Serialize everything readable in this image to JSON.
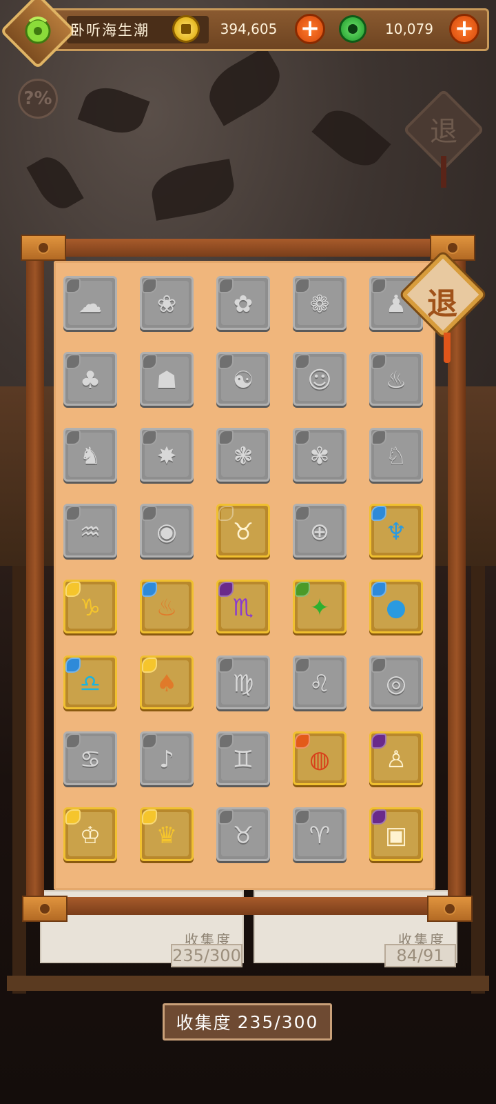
{
  "player": {
    "name": "卧听海生潮"
  },
  "currencies": [
    {
      "type": "gold-coin",
      "value": "394,605",
      "color": "#f5c52c"
    },
    {
      "type": "jade-coin",
      "value": "10,079",
      "color": "#2fb02f"
    }
  ],
  "buttons": {
    "add": "+",
    "help": "?%",
    "exit": "退"
  },
  "collection": {
    "label": "收集度",
    "progress": "235/300",
    "background_panels": [
      {
        "label": "收集度",
        "progress": "235/300"
      },
      {
        "label": "收集度",
        "progress": "84/91"
      }
    ]
  },
  "colors": {
    "accent": "#e0551a",
    "paper": "#f0b67c",
    "frame": "#8a4a20",
    "gold_border": "#f0c030"
  },
  "cards": [
    {
      "glyph": "☁",
      "state": "locked",
      "element": "sun"
    },
    {
      "glyph": "❀",
      "state": "locked",
      "element": "wind"
    },
    {
      "glyph": "✿",
      "state": "locked",
      "element": "water"
    },
    {
      "glyph": "❁",
      "state": "locked",
      "element": "earth"
    },
    {
      "glyph": "♟",
      "state": "locked",
      "element": "water"
    },
    {
      "glyph": "♣",
      "state": "locked",
      "element": "water"
    },
    {
      "glyph": "☗",
      "state": "locked",
      "element": "earth"
    },
    {
      "glyph": "☯",
      "state": "locked",
      "element": "dark"
    },
    {
      "glyph": "☺",
      "state": "locked",
      "element": "sun"
    },
    {
      "glyph": "♨",
      "state": "locked",
      "element": "water"
    },
    {
      "glyph": "♞",
      "state": "locked",
      "element": "water"
    },
    {
      "glyph": "✸",
      "state": "locked",
      "element": "sun"
    },
    {
      "glyph": "❃",
      "state": "locked",
      "element": "wind"
    },
    {
      "glyph": "✾",
      "state": "locked",
      "element": "water"
    },
    {
      "glyph": "♘",
      "state": "locked",
      "element": "earth"
    },
    {
      "glyph": "♒",
      "state": "locked",
      "element": "water"
    },
    {
      "glyph": "◉",
      "state": "locked",
      "element": "dark"
    },
    {
      "glyph": "♉",
      "state": "unlocked",
      "element": "earth",
      "tint": "cream"
    },
    {
      "glyph": "⊕",
      "state": "locked",
      "element": "sun"
    },
    {
      "glyph": "♆",
      "state": "unlocked",
      "element": "water",
      "tint": "blue"
    },
    {
      "glyph": "♑",
      "state": "unlocked",
      "element": "sun",
      "tint": "yellow"
    },
    {
      "glyph": "♨",
      "state": "unlocked",
      "element": "water",
      "tint": "orange"
    },
    {
      "glyph": "♏",
      "state": "unlocked",
      "element": "dark",
      "tint": "purple"
    },
    {
      "glyph": "✦",
      "state": "unlocked",
      "element": "wood",
      "tint": "green"
    },
    {
      "glyph": "●",
      "state": "unlocked",
      "element": "water",
      "tint": "blue"
    },
    {
      "glyph": "♎",
      "state": "unlocked",
      "element": "water",
      "tint": "cyan"
    },
    {
      "glyph": "♠",
      "state": "unlocked",
      "element": "sun",
      "tint": "orange"
    },
    {
      "glyph": "♍",
      "state": "locked",
      "element": "earth"
    },
    {
      "glyph": "♌",
      "state": "locked",
      "element": "earth"
    },
    {
      "glyph": "◎",
      "state": "locked",
      "element": "water"
    },
    {
      "glyph": "♋",
      "state": "locked",
      "element": "wind"
    },
    {
      "glyph": "♪",
      "state": "locked",
      "element": "earth"
    },
    {
      "glyph": "♊",
      "state": "locked",
      "element": "dark"
    },
    {
      "glyph": "◍",
      "state": "unlocked",
      "element": "fire",
      "tint": "red"
    },
    {
      "glyph": "♙",
      "state": "unlocked",
      "element": "dark",
      "tint": "cream"
    },
    {
      "glyph": "♔",
      "state": "unlocked",
      "element": "sun",
      "tint": "cream"
    },
    {
      "glyph": "♛",
      "state": "unlocked",
      "element": "sun",
      "tint": "yellow"
    },
    {
      "glyph": "♉",
      "state": "locked",
      "element": "earth"
    },
    {
      "glyph": "♈",
      "state": "locked",
      "element": "wind"
    },
    {
      "glyph": "▣",
      "state": "unlocked",
      "element": "dark",
      "tint": "cream"
    }
  ]
}
